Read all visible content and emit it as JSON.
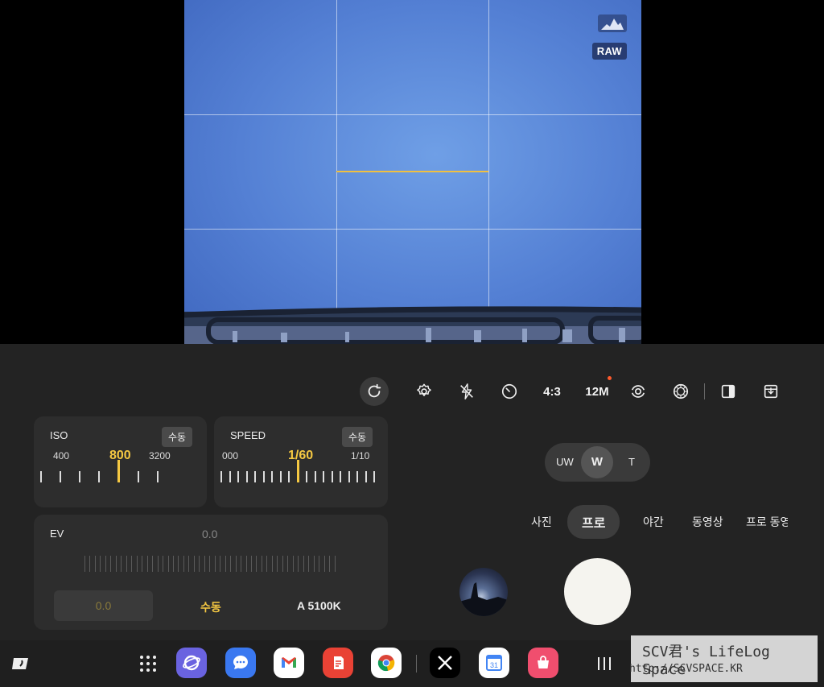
{
  "viewfinder": {
    "raw_badge": "RAW",
    "histogram_icon": "histogram-icon",
    "accent_color": "#f0c040"
  },
  "toolbar": {
    "ratio_label": "4:3",
    "resolution_label": "12M",
    "icons": [
      "reset-icon",
      "settings-icon",
      "flash-off-icon",
      "timer-icon",
      "rotate-lens-icon",
      "filter-icon",
      "split-view-icon",
      "save-options-icon"
    ]
  },
  "iso": {
    "title": "ISO",
    "mode": "수동",
    "values": [
      "400",
      "800",
      "3200"
    ],
    "selected": "800"
  },
  "speed": {
    "title": "SPEED",
    "mode": "수동",
    "values": [
      "000",
      "1/60",
      "1/10"
    ],
    "selected": "1/60"
  },
  "ev": {
    "title": "EV",
    "value": "0.0",
    "field_value": "0.0",
    "focus_mode": "수동",
    "white_balance": "A 5100K"
  },
  "zoom": {
    "options": [
      "UW",
      "W",
      "T"
    ],
    "selected": "W"
  },
  "modes": {
    "items": [
      "사진",
      "프로",
      "야간",
      "동영상",
      "프로 동영"
    ],
    "selected": "프로"
  },
  "taskbar": {
    "apps": [
      "samsung-internet",
      "messages",
      "gmail",
      "samsung-notes",
      "chrome",
      "x",
      "calendar",
      "galaxy-store"
    ],
    "calendar_day": "31"
  },
  "watermark": {
    "line1": "SCV君's LifeLog Space",
    "line2": "http://SCVSPACE.KR"
  }
}
